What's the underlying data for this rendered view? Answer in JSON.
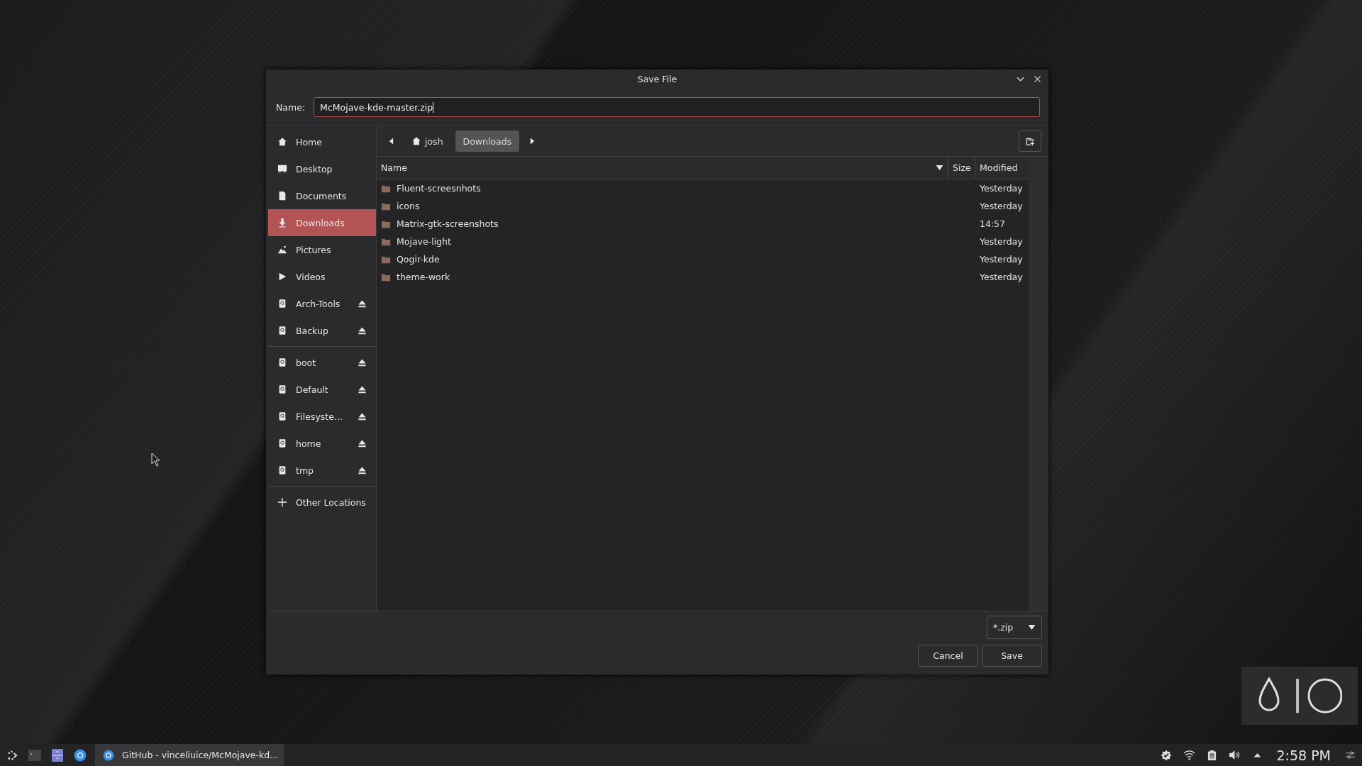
{
  "dialog": {
    "title": "Save File",
    "name_label": "Name:",
    "name_value": "McMojave-kde-master.zip"
  },
  "sidebar": [
    {
      "items": [
        {
          "label": "Home",
          "kind": "home",
          "ejectable": false,
          "selected": false
        },
        {
          "label": "Desktop",
          "kind": "desktop",
          "ejectable": false,
          "selected": false
        },
        {
          "label": "Documents",
          "kind": "document",
          "ejectable": false,
          "selected": false
        },
        {
          "label": "Downloads",
          "kind": "download",
          "ejectable": false,
          "selected": true
        },
        {
          "label": "Pictures",
          "kind": "pictures",
          "ejectable": false,
          "selected": false
        },
        {
          "label": "Videos",
          "kind": "videos",
          "ejectable": false,
          "selected": false
        },
        {
          "label": "Arch-Tools",
          "kind": "drive",
          "ejectable": true,
          "selected": false
        },
        {
          "label": "Backup",
          "kind": "drive",
          "ejectable": true,
          "selected": false
        }
      ]
    },
    {
      "items": [
        {
          "label": "boot",
          "kind": "drive",
          "ejectable": true,
          "selected": false
        },
        {
          "label": "Default",
          "kind": "drive",
          "ejectable": true,
          "selected": false
        },
        {
          "label": "Filesyste...",
          "kind": "drive",
          "ejectable": true,
          "selected": false
        },
        {
          "label": "home",
          "kind": "drive",
          "ejectable": true,
          "selected": false
        },
        {
          "label": "tmp",
          "kind": "drive",
          "ejectable": true,
          "selected": false
        }
      ]
    },
    {
      "items": [
        {
          "label": "Other Locations",
          "kind": "add",
          "ejectable": false,
          "selected": false
        }
      ]
    }
  ],
  "path_bar": {
    "crumbs": [
      {
        "label": "josh",
        "kind": "home",
        "selected": false
      },
      {
        "label": "Downloads",
        "kind": "folder",
        "selected": true
      }
    ]
  },
  "table": {
    "columns": [
      {
        "label": "Name",
        "sorted": true
      },
      {
        "label": "Size",
        "sorted": false
      },
      {
        "label": "Modified",
        "sorted": false
      }
    ],
    "rows": [
      {
        "name": "Fluent-screesnhots",
        "modified": "Yesterday"
      },
      {
        "name": "icons",
        "modified": "Yesterday"
      },
      {
        "name": "Matrix-gtk-screenshots",
        "modified": "14:57"
      },
      {
        "name": "Mojave-light",
        "modified": "Yesterday"
      },
      {
        "name": "Qogir-kde",
        "modified": "Yesterday"
      },
      {
        "name": "theme-work",
        "modified": "Yesterday"
      }
    ]
  },
  "filter": {
    "value": "*.zip"
  },
  "buttons": [
    {
      "label": "Cancel"
    },
    {
      "label": "Save"
    }
  ],
  "taskbar": {
    "task": "GitHub - vinceliuice/McMojave-kd...",
    "clock": "2:58 PM"
  }
}
